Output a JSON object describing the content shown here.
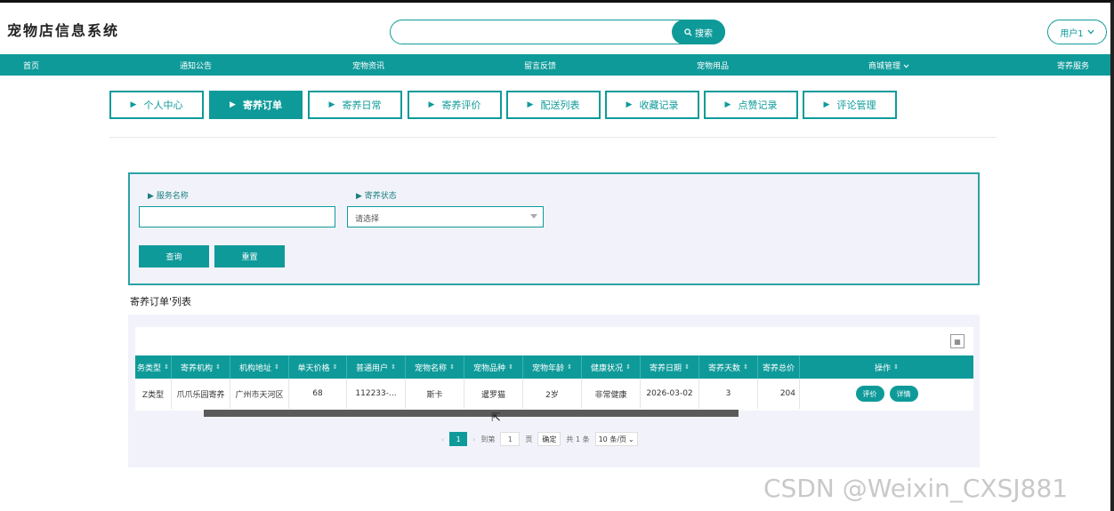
{
  "header": {
    "app_title": "宠物店信息系统",
    "search_placeholder": "",
    "search_button": "搜索",
    "user_label": "用户1"
  },
  "nav": {
    "items": [
      "首页",
      "通知公告",
      "宠物资讯",
      "留言反馈",
      "宠物用品",
      "商城管理",
      "寄养服务"
    ]
  },
  "tabs": [
    {
      "label": "个人中心",
      "active": false
    },
    {
      "label": "寄养订单",
      "active": true
    },
    {
      "label": "寄养日常",
      "active": false
    },
    {
      "label": "寄养评价",
      "active": false
    },
    {
      "label": "配送列表",
      "active": false
    },
    {
      "label": "收藏记录",
      "active": false
    },
    {
      "label": "点赞记录",
      "active": false
    },
    {
      "label": "评论管理",
      "active": false
    }
  ],
  "search_panel": {
    "service_name_label": "服务名称",
    "service_name_value": "",
    "status_label": "寄养状态",
    "status_placeholder": "请选择",
    "query_button": "查询",
    "reset_button": "重置"
  },
  "list": {
    "title": "寄养订单'列表",
    "columns": [
      "务类型",
      "寄养机构",
      "机构地址",
      "单天价格",
      "普通用户",
      "宠物名称",
      "宠物品种",
      "宠物年龄",
      "健康状况",
      "寄养日期",
      "寄养天数",
      "寄养总价",
      "操作"
    ],
    "rows": [
      {
        "cells": [
          "Z类型",
          "爪爪乐园寄养",
          "广州市天河区",
          "68",
          "112233-...",
          "斯卡",
          "暹罗猫",
          "2岁",
          "非常健康",
          "2026-03-02",
          "3",
          "204"
        ],
        "actions": [
          "评价",
          "详情"
        ]
      }
    ]
  },
  "pagination": {
    "current_page": "1",
    "goto_label": "到第",
    "goto_value": "1",
    "page_unit": "页",
    "confirm": "确定",
    "total": "共 1 条",
    "page_size": "10 条/页"
  },
  "watermark": "CSDN @Weixin_CXSJ881",
  "colors": {
    "accent": "#0f9a9a",
    "panel_bg": "#f2f3fa"
  }
}
